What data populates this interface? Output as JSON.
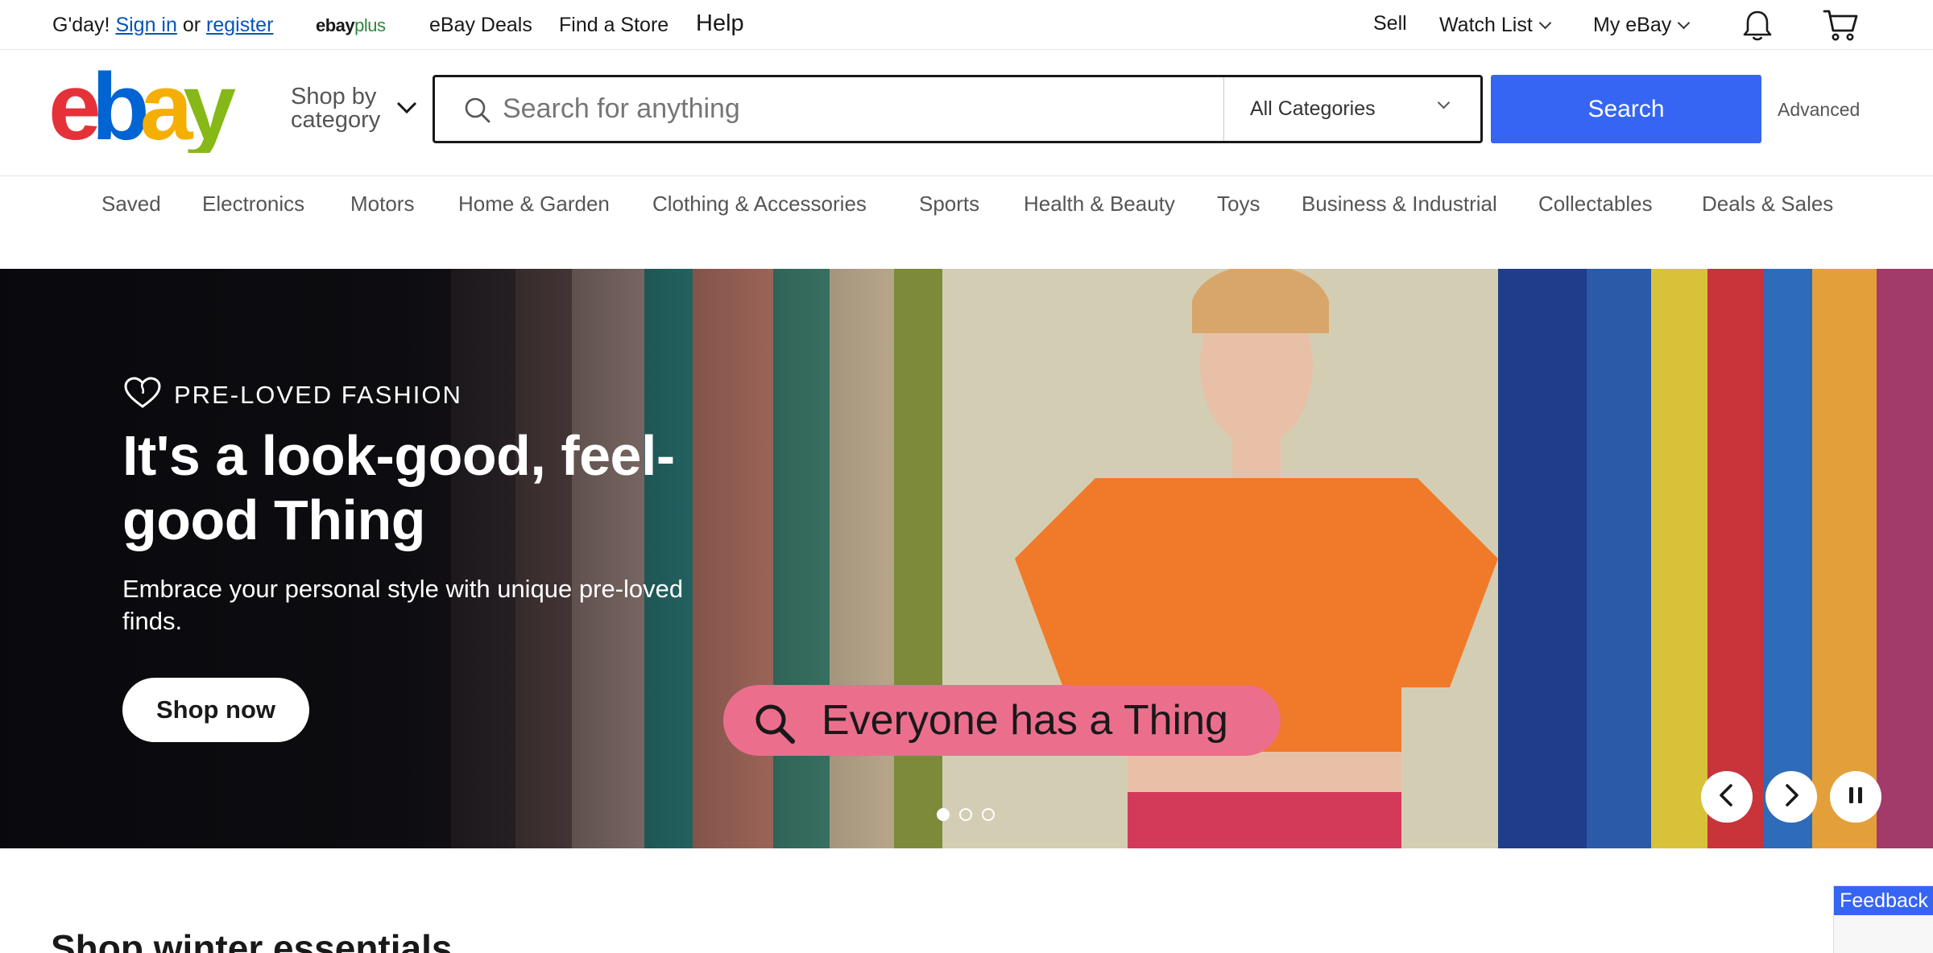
{
  "topbar": {
    "greeting": "G'day!",
    "sign_in": "Sign in",
    "or": "or",
    "register": "register",
    "ebayplus_ebay": "ebay",
    "ebayplus_plus": "plus",
    "deals": "eBay Deals",
    "find_store": "Find a Store",
    "help": "Help",
    "sell": "Sell",
    "watch_list": "Watch List",
    "my_ebay": "My eBay",
    "notification_icon": "bell-icon",
    "cart_icon": "cart-icon"
  },
  "header": {
    "shop_by_line1": "Shop by",
    "shop_by_line2": "category",
    "search_placeholder": "Search for anything",
    "search_value": "",
    "category": "All Categories",
    "search_button": "Search",
    "advanced": "Advanced"
  },
  "nav": {
    "items": [
      "Saved",
      "Electronics",
      "Motors",
      "Home & Garden",
      "Clothing & Accessories",
      "Sports",
      "Health & Beauty",
      "Toys",
      "Business & Industrial",
      "Collectables",
      "Deals & Sales"
    ]
  },
  "hero": {
    "eyebrow": "PRE-LOVED FASHION",
    "title": "It's a look-good, feel-good Thing",
    "subtitle": "Embrace your personal style with unique pre-loved finds.",
    "cta": "Shop now",
    "tagline": "Everyone has a Thing",
    "slides_total": 3,
    "slide_active": 1
  },
  "section": {
    "title": "Shop winter essentials"
  },
  "feedback": {
    "label": "Feedback"
  },
  "colors": {
    "accent": "#3665f3",
    "logo_e": "#e53238",
    "logo_b": "#0064d2",
    "logo_a": "#f5af02",
    "logo_y": "#86b817",
    "plus_green": "#2e8540",
    "pill_pink": "#ec6e8d"
  }
}
